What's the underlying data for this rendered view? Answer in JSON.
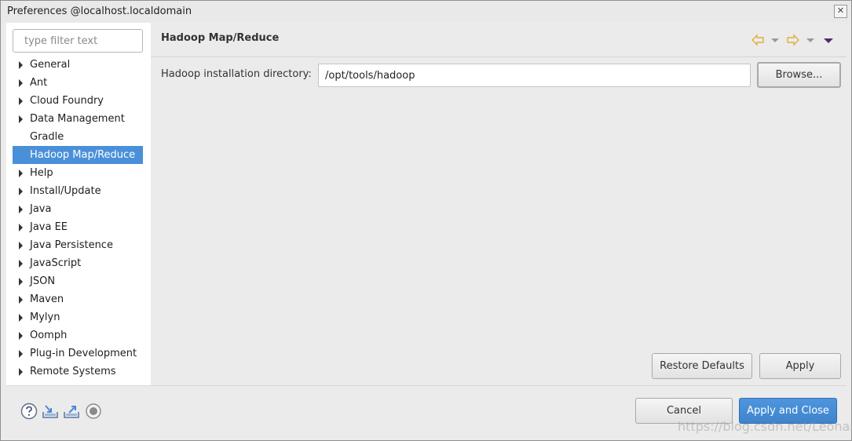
{
  "window": {
    "title": "Preferences @localhost.localdomain",
    "close_glyph": "✕"
  },
  "sidebar": {
    "filter_placeholder": "type filter text",
    "filter_value": "",
    "items": [
      {
        "label": "General",
        "expandable": true
      },
      {
        "label": "Ant",
        "expandable": true
      },
      {
        "label": "Cloud Foundry",
        "expandable": true
      },
      {
        "label": "Data Management",
        "expandable": true
      },
      {
        "label": "Gradle",
        "expandable": false
      },
      {
        "label": "Hadoop Map/Reduce",
        "expandable": false,
        "selected": true
      },
      {
        "label": "Help",
        "expandable": true
      },
      {
        "label": "Install/Update",
        "expandable": true
      },
      {
        "label": "Java",
        "expandable": true
      },
      {
        "label": "Java EE",
        "expandable": true
      },
      {
        "label": "Java Persistence",
        "expandable": true
      },
      {
        "label": "JavaScript",
        "expandable": true
      },
      {
        "label": "JSON",
        "expandable": true
      },
      {
        "label": "Maven",
        "expandable": true
      },
      {
        "label": "Mylyn",
        "expandable": true
      },
      {
        "label": "Oomph",
        "expandable": true
      },
      {
        "label": "Plug-in Development",
        "expandable": true
      },
      {
        "label": "Remote Systems",
        "expandable": true
      }
    ]
  },
  "page": {
    "title": "Hadoop Map/Reduce",
    "nav_icons": [
      "back-arrow-icon",
      "back-dropdown-icon",
      "forward-arrow-icon",
      "forward-dropdown-icon",
      "view-menu-icon"
    ],
    "hadoop_dir_label": "Hadoop installation directory:",
    "hadoop_dir_value": "/opt/tools/hadoop",
    "browse_label": "Browse...",
    "restore_defaults_label": "Restore Defaults",
    "apply_label": "Apply"
  },
  "footer": {
    "icons": [
      "help-icon",
      "import-icon",
      "export-icon",
      "record-icon"
    ],
    "cancel_label": "Cancel",
    "apply_close_label": "Apply and Close"
  },
  "watermark": "https://blog.csdn.net/Leonardy",
  "colors": {
    "selection": "#4a90d9",
    "primary_button": "#4589d2",
    "nav_arrow": "#e6b93c"
  }
}
